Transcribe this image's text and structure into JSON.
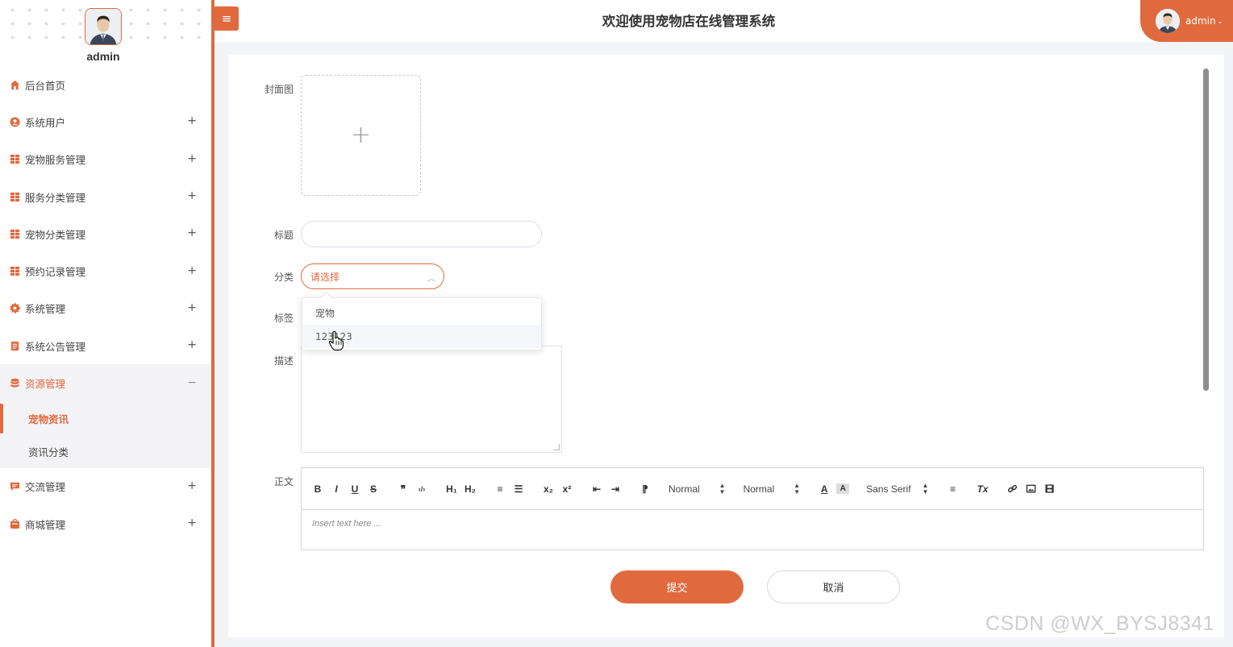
{
  "sidebar": {
    "username": "admin",
    "menu": [
      {
        "label": "后台首页",
        "icon": "home-icon",
        "toggle": ""
      },
      {
        "label": "系统用户",
        "icon": "user-icon",
        "toggle": "+"
      },
      {
        "label": "宠物服务管理",
        "icon": "grid-icon",
        "toggle": "+"
      },
      {
        "label": "服务分类管理",
        "icon": "grid-icon",
        "toggle": "+"
      },
      {
        "label": "宠物分类管理",
        "icon": "grid-icon",
        "toggle": "+"
      },
      {
        "label": "预约记录管理",
        "icon": "grid-icon",
        "toggle": "+"
      },
      {
        "label": "系统管理",
        "icon": "gear-icon",
        "toggle": "+"
      },
      {
        "label": "系统公告管理",
        "icon": "notice-icon",
        "toggle": "+"
      },
      {
        "label": "资源管理",
        "icon": "database-icon",
        "toggle": "−"
      },
      {
        "label": "交流管理",
        "icon": "chat-icon",
        "toggle": "+"
      },
      {
        "label": "商城管理",
        "icon": "shop-icon",
        "toggle": "+"
      }
    ],
    "submenu": [
      {
        "label": "宠物资讯",
        "active": true
      },
      {
        "label": "资讯分类",
        "active": false
      }
    ]
  },
  "header": {
    "menu_button": "≡",
    "title": "欢迎使用宠物店在线管理系统",
    "user": "admin",
    "user_caret": "⌄"
  },
  "form": {
    "cover_label": "封面图",
    "upload_plus": "+",
    "title_label": "标题",
    "title_value": "",
    "category_label": "分类",
    "category_placeholder": "请选择",
    "category_options": [
      "宠物",
      "123123"
    ],
    "tag_label": "标签",
    "desc_label": "描述",
    "body_label": "正文",
    "editor_placeholder": "Insert text here ...",
    "toolbar": {
      "bold": "B",
      "italic": "I",
      "underline": "U",
      "strike": "S",
      "quote": "❞",
      "code": "‹/›",
      "h1": "H₁",
      "h2": "H₂",
      "ol": "≡",
      "ul": "☰",
      "sub": "x₂",
      "sup": "x²",
      "outdent": "⇤",
      "indent": "⇥",
      "direction": "⁋",
      "size": "Normal",
      "header": "Normal",
      "color": "A",
      "background": "A",
      "font": "Sans Serif",
      "align": "≡",
      "clean": "Tx"
    },
    "submit": "提交",
    "cancel": "取消"
  },
  "watermark": "CSDN @WX_BYSJ8341",
  "colors": {
    "accent": "#e06a3e"
  }
}
